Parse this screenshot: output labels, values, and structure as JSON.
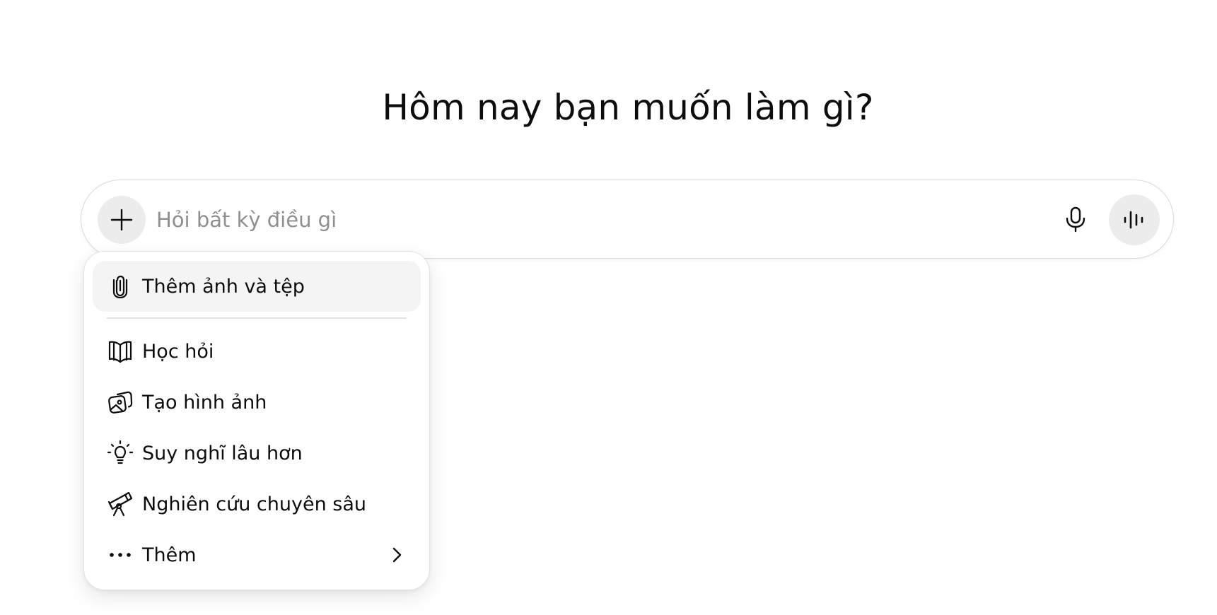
{
  "heading": "Hôm nay bạn muốn làm gì?",
  "composer": {
    "placeholder": "Hỏi bất kỳ điều gì",
    "value": "",
    "plus_icon": "plus-icon",
    "mic_icon": "microphone-icon",
    "voice_icon": "voice-waveform-icon"
  },
  "menu": {
    "items": [
      {
        "label": "Thêm ảnh và tệp",
        "icon": "paperclip-icon",
        "active": true
      },
      {
        "label": "Học hỏi",
        "icon": "open-book-icon"
      },
      {
        "label": "Tạo hình ảnh",
        "icon": "image-icon"
      },
      {
        "label": "Suy nghĩ lâu hơn",
        "icon": "lightbulb-icon"
      },
      {
        "label": "Nghiên cứu chuyên sâu",
        "icon": "telescope-icon"
      },
      {
        "label": "Thêm",
        "icon": "more-dots-icon",
        "has_submenu": true
      }
    ]
  },
  "colors": {
    "text": "#0d0d0d",
    "placeholder": "#8f8f8f",
    "button_bg": "#ececec",
    "hover_bg": "#f4f4f4",
    "border": "#d9d9d9"
  }
}
